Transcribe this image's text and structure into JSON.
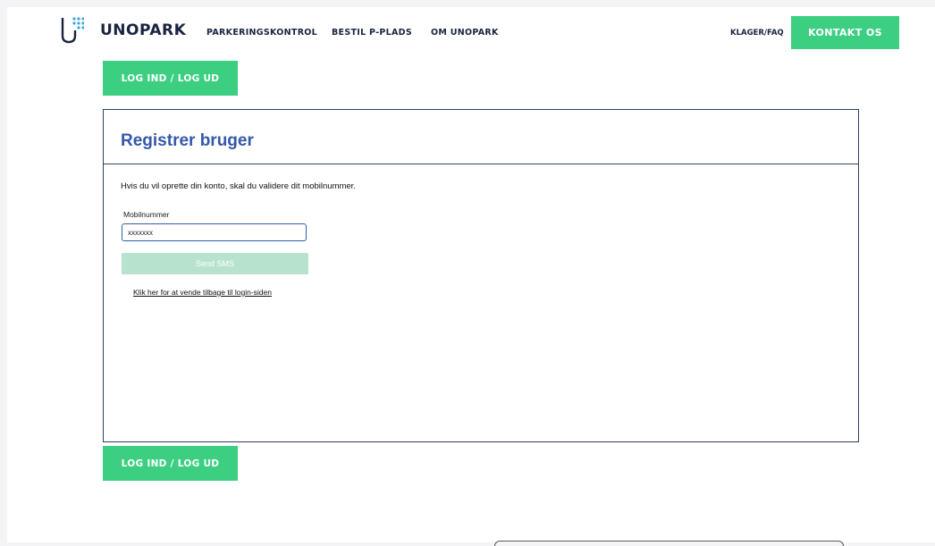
{
  "header": {
    "logo_text": "UNOPARK",
    "nav": [
      "PARKERINGSKONTROL",
      "BESTIL P-PLADS",
      "OM UNOPARK"
    ],
    "faq": "KLAGER/FAQ",
    "contact_button": "KONTAKT OS"
  },
  "login_button": "LOG IND / LOG UD",
  "form": {
    "title": "Registrer bruger",
    "intro": "Hvis du vil oprette din konto, skal du validere dit mobilnummer.",
    "phone_label": "Mobilnummer",
    "phone_value": "xxxxxxx",
    "send_button": "Send SMS",
    "back_link": "Klik her for at vende tilbage til login-siden"
  },
  "colors": {
    "accent_green": "#3ccf82",
    "navy": "#1a2340",
    "title_blue": "#3558a8",
    "logo_dots": "#3aa6d9"
  }
}
